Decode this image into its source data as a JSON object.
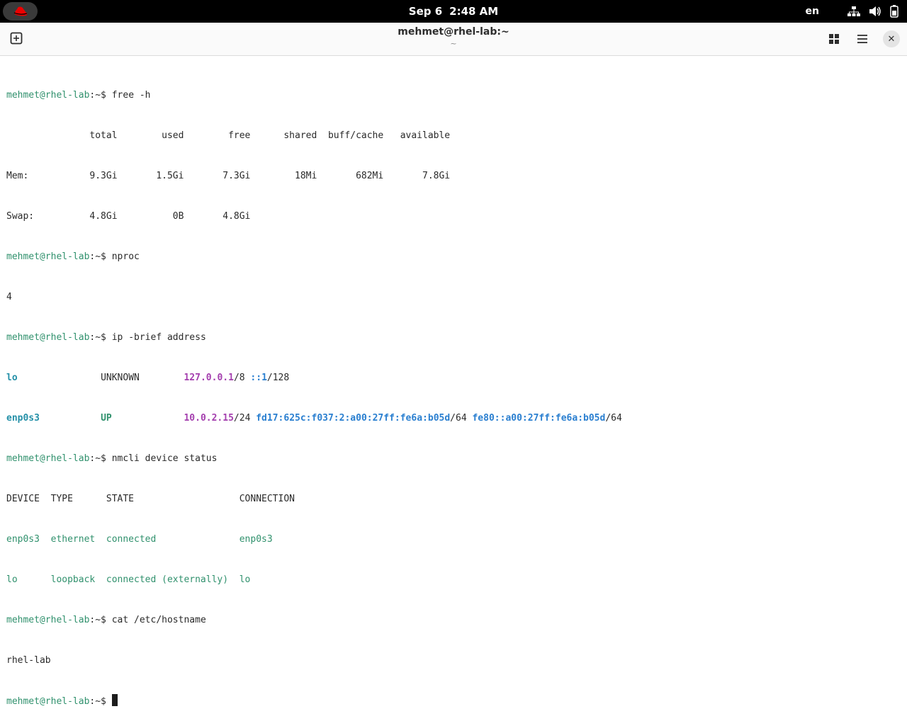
{
  "topbar": {
    "date": "Sep 6",
    "time": "2:48 AM",
    "lang": "en",
    "icons": [
      "redhat-logo-icon",
      "network-icon",
      "volume-icon",
      "battery-icon"
    ]
  },
  "window": {
    "title": "mehmet@rhel-lab:~",
    "subtitle": "~",
    "close_label": "✕"
  },
  "terminal": {
    "prompt_user": "mehmet@rhel-lab",
    "prompt_sep": ":~$ ",
    "cmd1": "free -h",
    "free_header": "               total        used        free      shared  buff/cache   available",
    "free_mem": "Mem:           9.3Gi       1.5Gi       7.3Gi        18Mi       682Mi       7.8Gi",
    "free_swap": "Swap:          4.8Gi          0B       4.8Gi",
    "cmd2": "nproc",
    "nproc_out": "4",
    "cmd3": "ip -brief address",
    "ip_lo_name": "lo",
    "ip_lo_pad": "               ",
    "ip_lo_state": "UNKNOWN",
    "ip_lo_pad2": "        ",
    "ip_lo_addr1": "127.0.0.1",
    "ip_lo_addr1_mask": "/8 ",
    "ip_lo_addr2": "::1",
    "ip_lo_addr2_mask": "/128",
    "ip_enp_name": "enp0s3",
    "ip_enp_pad": "           ",
    "ip_enp_state": "UP",
    "ip_enp_pad2": "             ",
    "ip_enp_addr1": "10.0.2.15",
    "ip_enp_addr1_mask": "/24 ",
    "ip_enp_addr2": "fd17:625c:f037:2:a00:27ff:fe6a:b05d",
    "ip_enp_addr2_mask": "/64 ",
    "ip_enp_addr3": "fe80::a00:27ff:fe6a:b05d",
    "ip_enp_addr3_mask": "/64",
    "cmd4": "nmcli device status",
    "nm_header": "DEVICE  TYPE      STATE                   CONNECTION",
    "nm_row1": "enp0s3  ethernet  connected               enp0s3",
    "nm_row2": "lo      loopback  connected (externally)  lo",
    "cmd5": "cat /etc/hostname",
    "hostname_out": "rhel-lab"
  }
}
